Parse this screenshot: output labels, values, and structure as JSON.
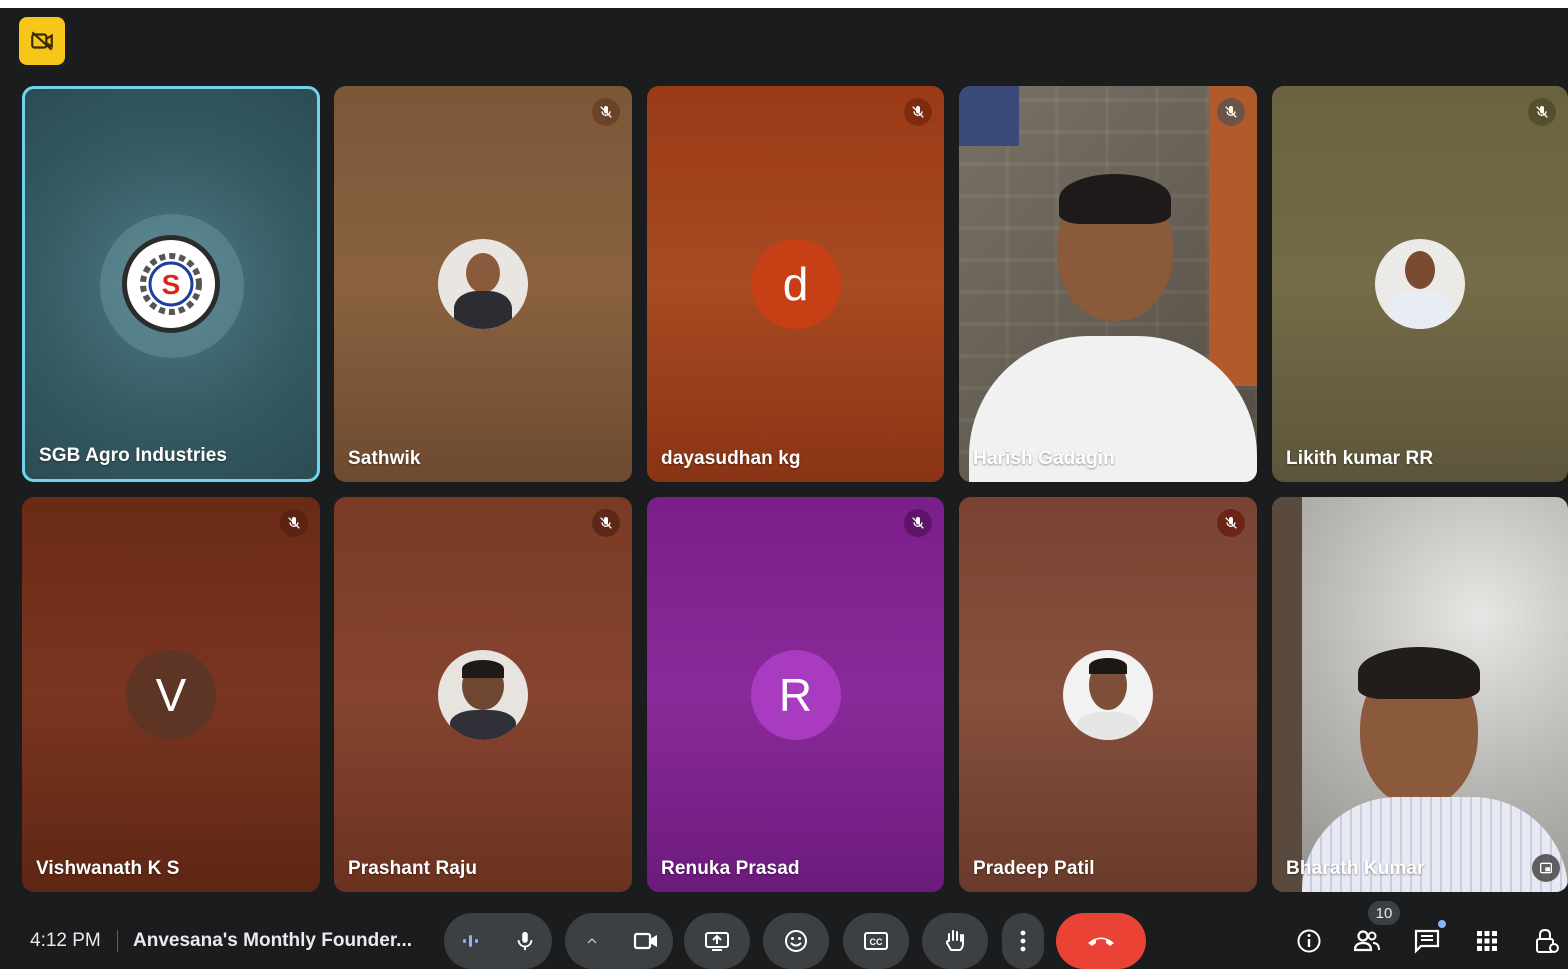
{
  "meeting": {
    "time": "4:12 PM",
    "title": "Anvesana's Monthly Founder..."
  },
  "participants": [
    {
      "name": "SGB Agro Industries",
      "avatar": "sgb-logo"
    },
    {
      "name": "Sathwik",
      "avatar": "photo"
    },
    {
      "name": "dayasudhan kg",
      "avatar": "letter",
      "letter": "d"
    },
    {
      "name": "Harish Gadagin",
      "avatar": "video"
    },
    {
      "name": "Likith kumar RR",
      "avatar": "photo"
    },
    {
      "name": "Vishwanath K S",
      "avatar": "letter",
      "letter": "V"
    },
    {
      "name": "Prashant Raju",
      "avatar": "photo"
    },
    {
      "name": "Renuka Prasad",
      "avatar": "letter",
      "letter": "R"
    },
    {
      "name": "Pradeep Patil",
      "avatar": "photo"
    },
    {
      "name": "Bharath Kumar",
      "avatar": "video"
    }
  ],
  "people_count": "10",
  "colors": {
    "background": "#1b1c1e",
    "active_border": "#6fd3ee",
    "end_call": "#ea4335",
    "recording_badge": "#f7c61a",
    "control_bg": "#3c4043"
  },
  "icons": {
    "recording": "video-off-icon",
    "muted": "mic-off-icon",
    "captions": "cc-icon",
    "raise_hand": "hand-icon",
    "more": "more-vert-icon",
    "end_call": "call-end-icon",
    "info": "info-icon",
    "people": "people-icon",
    "chat": "chat-icon",
    "activities": "apps-grid-icon",
    "host_controls": "lock-person-icon"
  }
}
